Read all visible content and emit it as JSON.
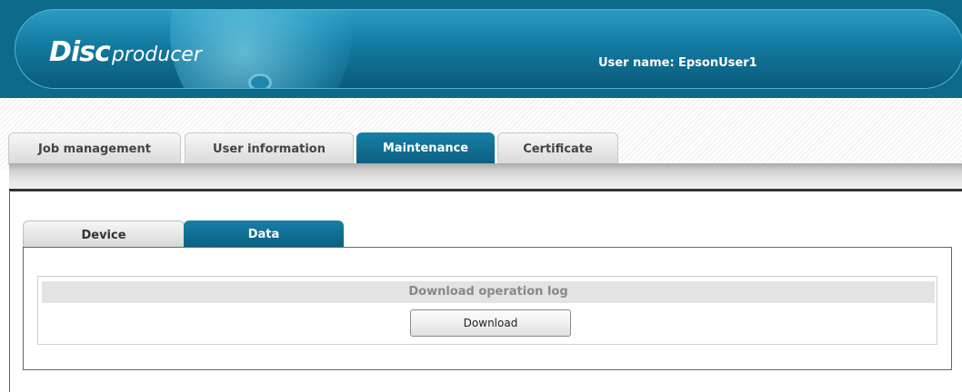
{
  "header": {
    "logo_disc": "Disc",
    "logo_producer": "producer",
    "user_label": "User name:",
    "user_value": "EpsonUser1"
  },
  "tabs": [
    {
      "label": "Job management",
      "active": false
    },
    {
      "label": "User information",
      "active": false
    },
    {
      "label": "Maintenance",
      "active": true
    },
    {
      "label": "Certificate",
      "active": false
    }
  ],
  "subtabs": [
    {
      "label": "Device",
      "active": false
    },
    {
      "label": "Data",
      "active": true
    }
  ],
  "data_panel": {
    "section_title": "Download operation log",
    "download_button": "Download"
  },
  "colors": {
    "accent": "#0e6a8a",
    "tab_active": "#0b5f80"
  }
}
